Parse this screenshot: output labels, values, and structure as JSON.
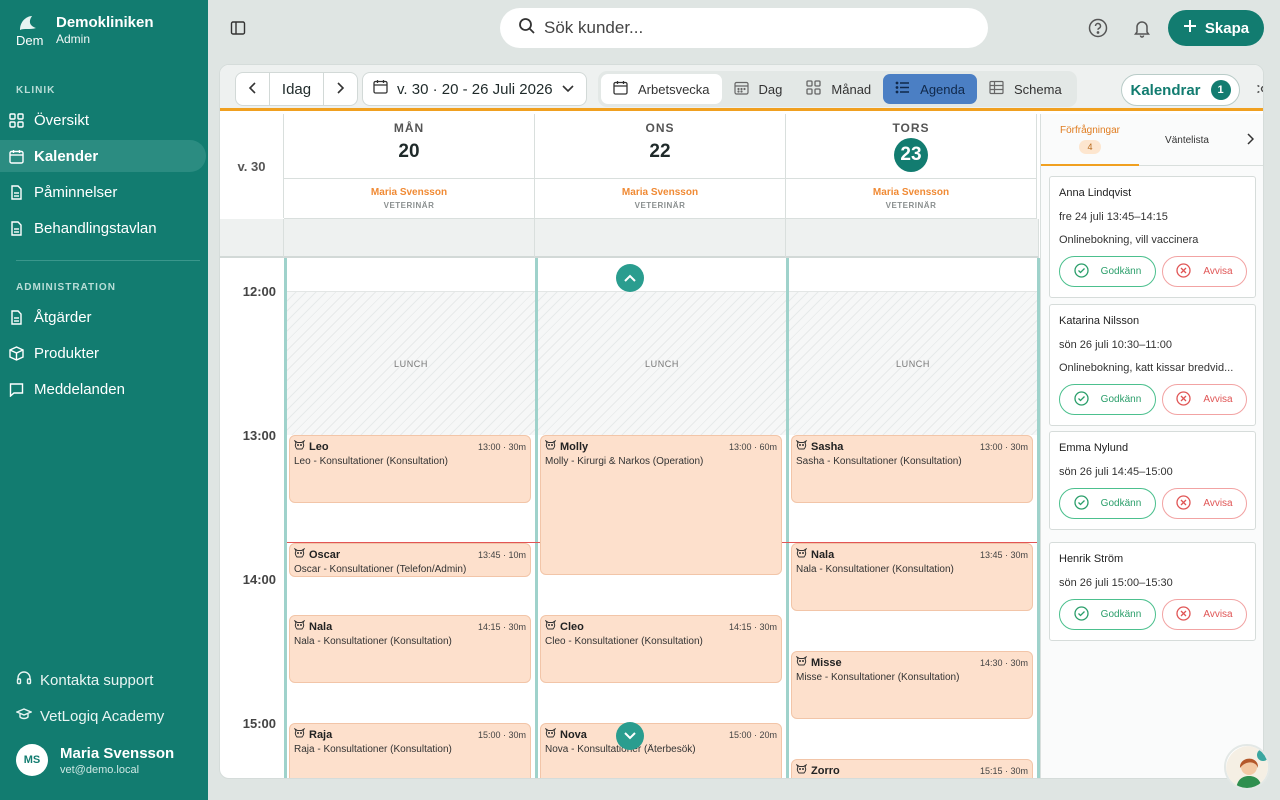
{
  "brand": {
    "name": "Demokliniken",
    "role": "Admin",
    "logo_text": "Dem"
  },
  "sidebar": {
    "section_clinic": "KLINIK",
    "clinic_items": [
      {
        "label": "Översikt",
        "icon": "grid-icon"
      },
      {
        "label": "Kalender",
        "icon": "calendar-icon",
        "active": true
      },
      {
        "label": "Påminnelser",
        "icon": "document-icon"
      },
      {
        "label": "Behandlingstavlan",
        "icon": "document-icon"
      }
    ],
    "section_admin": "ADMINISTRATION",
    "admin_items": [
      {
        "label": "Åtgärder",
        "icon": "document-icon"
      },
      {
        "label": "Produkter",
        "icon": "box-icon"
      },
      {
        "label": "Meddelanden",
        "icon": "chat-icon"
      }
    ],
    "support": "Kontakta support",
    "academy": "VetLogiq Academy",
    "user": {
      "initials": "MS",
      "name": "Maria Svensson",
      "email": "vet@demo.local"
    }
  },
  "topbar": {
    "search_placeholder": "Sök kunder...",
    "create_label": "Skapa"
  },
  "toolbar": {
    "today": "Idag",
    "range": "v. 30 · 20 - 26 Juli 2026",
    "views": [
      "Arbetsvecka",
      "Dag",
      "Månad",
      "Agenda",
      "Schema"
    ],
    "selected_view": "Arbetsvecka",
    "active_view": "Agenda",
    "calendars_label": "Kalendrar",
    "calendars_count": "1"
  },
  "calendar": {
    "week": "v. 30",
    "days": [
      {
        "name": "MÅN",
        "num": "20",
        "today": false
      },
      {
        "name": "ONS",
        "num": "22",
        "today": false
      },
      {
        "name": "TORS",
        "num": "23",
        "today": true
      }
    ],
    "staff_name": "Maria Svensson",
    "staff_role": "VETERINÄR",
    "times": [
      "12:00",
      "13:00",
      "14:00",
      "15:00"
    ],
    "lunch_label": "LUNCH",
    "appointments": [
      {
        "day": 0,
        "name": "Leo",
        "time": "13:00 · 30m",
        "desc": "Leo - Konsultationer (Konsultation)"
      },
      {
        "day": 0,
        "name": "Oscar",
        "time": "13:45 · 10m",
        "desc": "Oscar - Konsultationer (Telefon/Admin)"
      },
      {
        "day": 0,
        "name": "Nala",
        "time": "14:15 · 30m",
        "desc": "Nala - Konsultationer (Konsultation)"
      },
      {
        "day": 0,
        "name": "Raja",
        "time": "15:00 · 30m",
        "desc": "Raja - Konsultationer (Konsultation)"
      },
      {
        "day": 1,
        "name": "Molly",
        "time": "13:00 · 60m",
        "desc": "Molly - Kirurgi & Narkos (Operation)"
      },
      {
        "day": 1,
        "name": "Cleo",
        "time": "14:15 · 30m",
        "desc": "Cleo - Konsultationer (Konsultation)"
      },
      {
        "day": 1,
        "name": "Nova",
        "time": "15:00 · 20m",
        "desc": "Nova - Konsultationer (Återbesök)"
      },
      {
        "day": 2,
        "name": "Sasha",
        "time": "13:00 · 30m",
        "desc": "Sasha - Konsultationer (Konsultation)"
      },
      {
        "day": 2,
        "name": "Nala",
        "time": "13:45 · 30m",
        "desc": "Nala - Konsultationer (Konsultation)"
      },
      {
        "day": 2,
        "name": "Misse",
        "time": "14:30 · 30m",
        "desc": "Misse - Konsultationer (Konsultation)"
      },
      {
        "day": 2,
        "name": "Zorro",
        "time": "15:15 · 30m",
        "desc": ""
      }
    ]
  },
  "requests_panel": {
    "tab_requests": "Förfrågningar",
    "tab_requests_count": "4",
    "tab_waitlist": "Väntelista",
    "approve": "Godkänn",
    "reject": "Avvisa",
    "requests": [
      {
        "name": "Anna Lindqvist",
        "time": "fre 24 juli 13:45–14:15",
        "note": "Onlinebokning, vill vaccinera"
      },
      {
        "name": "Katarina Nilsson",
        "time": "sön 26 juli 10:30–11:00",
        "note": "Onlinebokning, katt kissar bredvid..."
      },
      {
        "name": "Emma Nylund",
        "time": "sön 26 juli 14:45–15:00",
        "note": ""
      },
      {
        "name": "Henrik Ström",
        "time": "sön 26 juli 15:00–15:30",
        "note": ""
      }
    ]
  },
  "colors": {
    "brand": "#127c70",
    "accent_orange": "#f0a020",
    "appointment": "#fde0cc",
    "active_view": "#4b7fc4"
  }
}
